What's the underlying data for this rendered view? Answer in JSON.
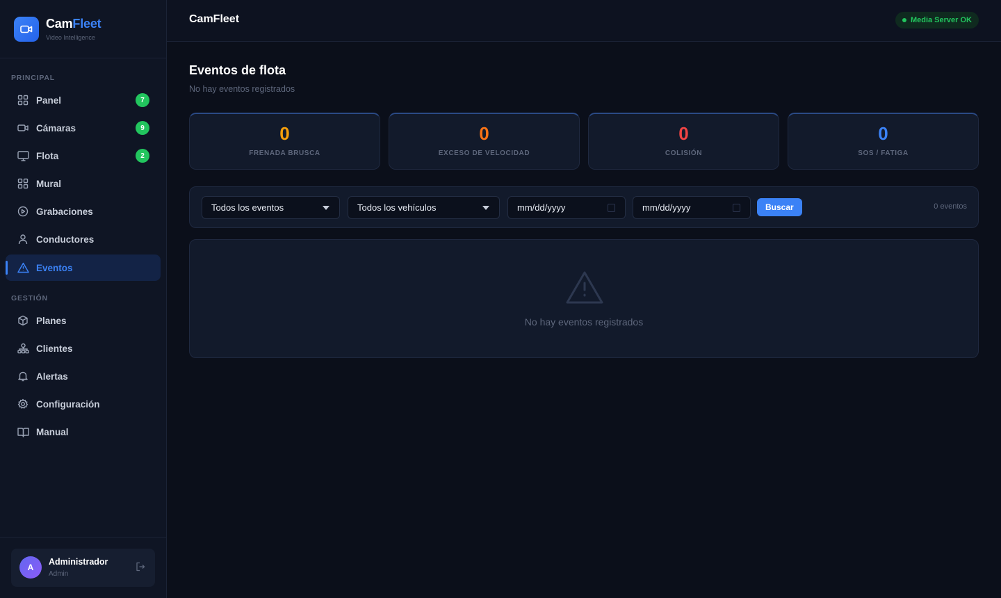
{
  "brand": {
    "name_a": "Cam",
    "name_b": "Fleet",
    "subtitle": "Video Intelligence"
  },
  "sidebar": {
    "section_principal": "PRINCIPAL",
    "section_gestion": "GESTIÓN",
    "principal_items": [
      {
        "label": "Panel",
        "icon": "grid-icon",
        "badge": "7"
      },
      {
        "label": "Cámaras",
        "icon": "video-camera-icon",
        "badge": "9"
      },
      {
        "label": "Flota",
        "icon": "monitor-icon",
        "badge": "2"
      },
      {
        "label": "Mural",
        "icon": "grid-icon"
      },
      {
        "label": "Grabaciones",
        "icon": "play-circle-icon"
      },
      {
        "label": "Conductores",
        "icon": "user-icon"
      },
      {
        "label": "Eventos",
        "icon": "warning-triangle-icon",
        "active": true
      }
    ],
    "gestion_items": [
      {
        "label": "Planes",
        "icon": "package-icon"
      },
      {
        "label": "Clientes",
        "icon": "network-icon"
      },
      {
        "label": "Alertas",
        "icon": "bell-icon"
      },
      {
        "label": "Configuración",
        "icon": "gear-icon"
      },
      {
        "label": "Manual",
        "icon": "book-icon"
      }
    ],
    "user": {
      "initial": "A",
      "name": "Administrador",
      "role": "Admin"
    }
  },
  "topbar": {
    "title": "CamFleet",
    "status": "Media Server OK"
  },
  "main": {
    "title": "Eventos de flota",
    "subtitle": "No hay eventos registrados",
    "stats": [
      {
        "value": "0",
        "label": "FRENADA BRUSCA",
        "color": "#f59e0b"
      },
      {
        "value": "0",
        "label": "EXCESO DE VELOCIDAD",
        "color": "#f97316"
      },
      {
        "value": "0",
        "label": "COLISIÓN",
        "color": "#ef4444"
      },
      {
        "value": "0",
        "label": "SOS / FATIGA",
        "color": "#3b82f6"
      }
    ],
    "filters": {
      "event_type": "Todos los eventos",
      "vehicle": "Todos los vehículos",
      "date_from": "mm/dd/yyyy",
      "date_to": "mm/dd/yyyy",
      "search_label": "Buscar",
      "count": "0 eventos"
    },
    "empty_message": "No hay eventos registrados"
  }
}
